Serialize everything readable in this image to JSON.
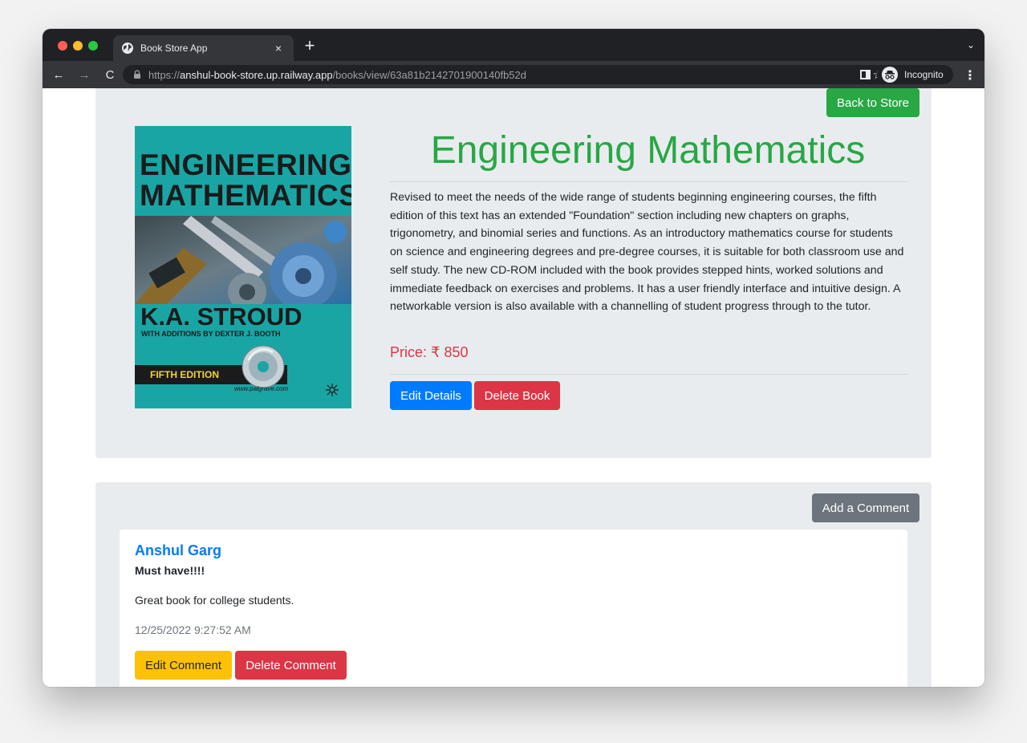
{
  "browser": {
    "tab_title": "Book Store App",
    "tab_close": "×",
    "new_tab": "+",
    "tab_menu": "⌄",
    "nav_back": "←",
    "nav_forward": "→",
    "nav_reload": "C",
    "url_scheme": "https://",
    "url_host": "anshul-book-store.up.railway.app",
    "url_path": "/books/view/63a81b2142701900140fb52d",
    "star": "☆",
    "incognito_label": "Incognito",
    "menu": "⋮"
  },
  "book": {
    "back_label": "Back to Store",
    "cover": {
      "title_line1": "ENGINEERING",
      "title_line2": "MATHEMATICS",
      "author": "K.A. STROUD",
      "additions": "WITH ADDITIONS BY DEXTER J. BOOTH",
      "edition": "FIFTH EDITION",
      "publisher_url": "www.palgrave.com"
    },
    "title": "Engineering Mathematics",
    "description": "Revised to meet the needs of the wide range of students beginning engineering courses, the fifth edition of this text has an extended \"Foundation\" section including new chapters on graphs, trigonometry, and binomial series and functions. As an introductory mathematics course for students on science and engineering degrees and pre-degree courses, it is suitable for both classroom use and self study. The new CD-ROM included with the book provides stepped hints, worked solutions and immediate feedback on exercises and problems. It has a user friendly interface and intuitive design. A networkable version is also available with a channelling of student progress through to the tutor.",
    "price": "Price: ₹ 850",
    "edit_label": "Edit Details",
    "delete_label": "Delete Book"
  },
  "comments": {
    "add_label": "Add a Comment",
    "items": [
      {
        "author": "Anshul Garg",
        "headline": "Must have!!!!",
        "body": "Great book for college students.",
        "time": "12/25/2022 9:27:52 AM",
        "edit_label": "Edit Comment",
        "delete_label": "Delete Comment"
      }
    ]
  },
  "colors": {
    "success": "#28a745",
    "primary": "#007bff",
    "danger": "#dc3545",
    "secondary": "#6c757d",
    "warning": "#ffc107",
    "card_bg": "#e9ecef"
  }
}
